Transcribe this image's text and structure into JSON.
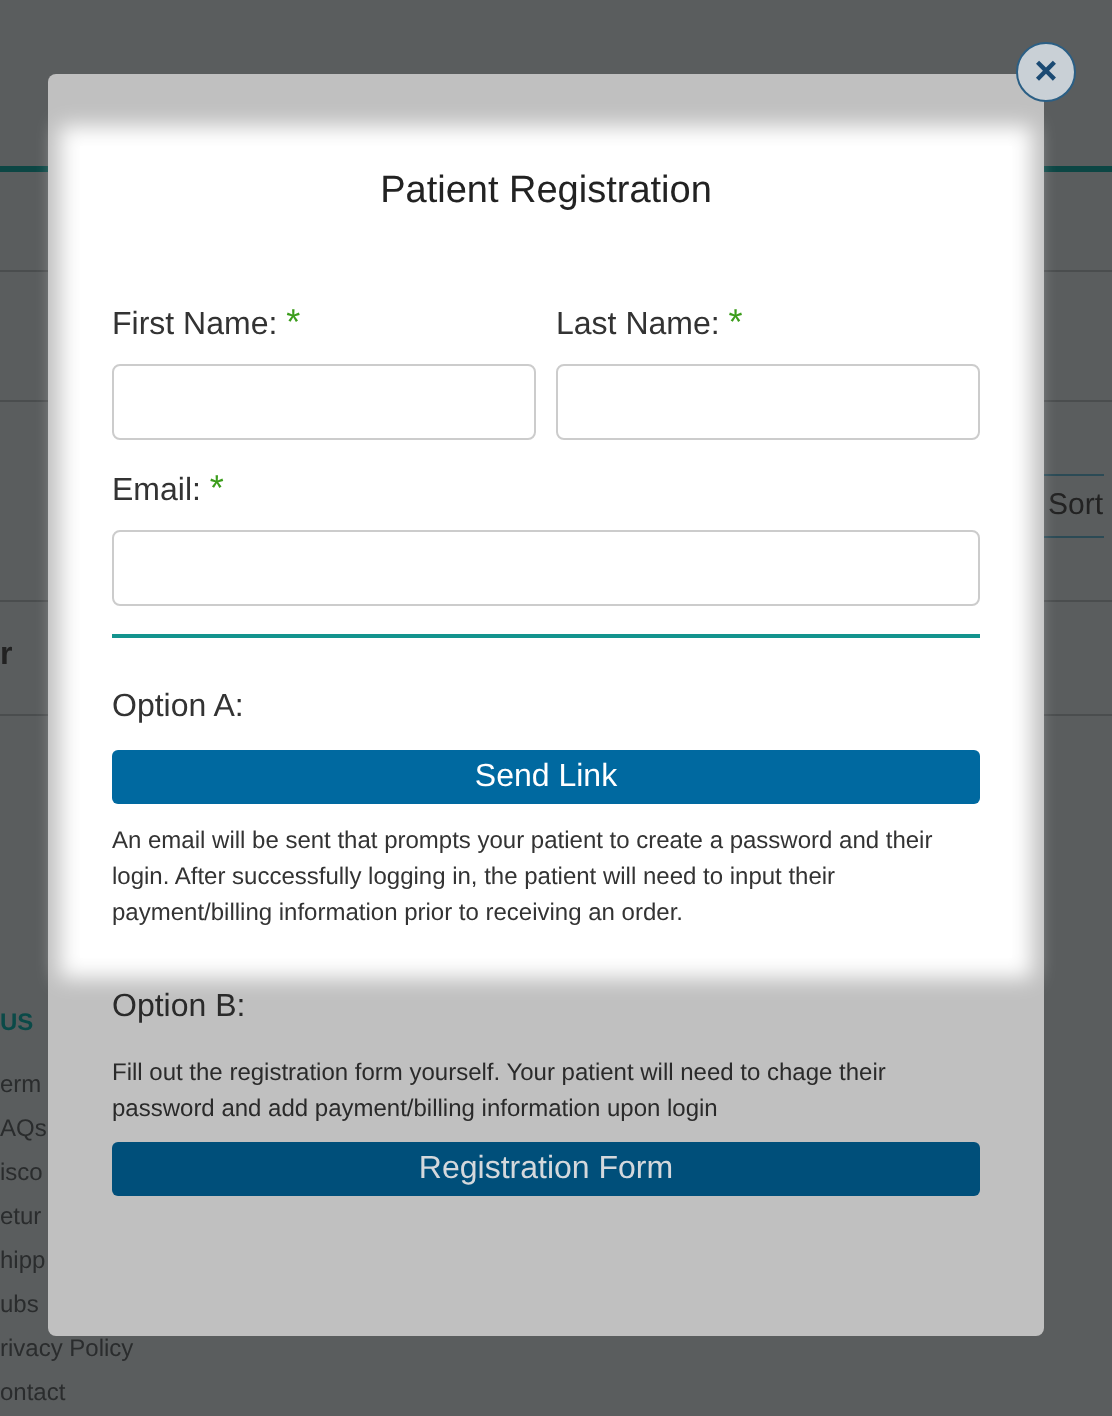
{
  "background_page": {
    "sort_button": "Sort",
    "table_header": "r",
    "footer": {
      "heading": "US",
      "links": [
        "erm",
        "AQs",
        "isco",
        "etur",
        "hipp",
        "ubs",
        "rivacy Policy",
        "ontact"
      ]
    }
  },
  "modal": {
    "close": "×",
    "title": "Patient Registration",
    "name_fields": [
      {
        "label": "First Name:",
        "required_mark": "*"
      },
      {
        "label": "Last Name:",
        "required_mark": "*"
      }
    ],
    "email_field": {
      "label": "Email:",
      "required_mark": "*"
    },
    "option_a": {
      "heading": "Option A:",
      "button": "Send Link",
      "description": "An email will be sent that prompts your patient to create a password and their login. After successfully logging in, the patient will need to input their payment/billing information prior to receiving an order."
    },
    "option_b": {
      "heading": "Option B:",
      "description": "Fill out the registration form yourself. Your patient will need to chage their password and add payment/billing information upon login",
      "button": "Registration Form"
    }
  }
}
